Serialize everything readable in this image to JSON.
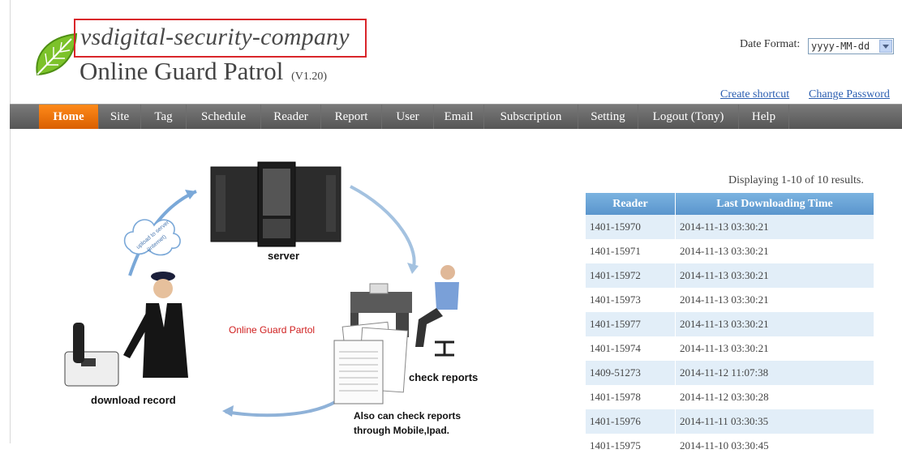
{
  "header": {
    "company_name": "vsdigital-security-company",
    "app_title": "Online Guard Patrol",
    "app_version": "(V1.20)",
    "date_format_label": "Date Format:",
    "date_format_value": "yyyy-MM-dd",
    "links": {
      "create_shortcut": "Create shortcut",
      "change_password": "Change Password"
    }
  },
  "nav": {
    "active": "Home",
    "items": [
      "Home",
      "Site",
      "Tag",
      "Schedule",
      "Reader",
      "Report",
      "User",
      "Email",
      "Subscription",
      "Setting",
      "Logout (Tony)",
      "Help"
    ]
  },
  "diagram": {
    "server_label": "server",
    "check_reports_label": "check reports",
    "download_record_label": "download record",
    "center_label": "Online Guard Partol",
    "mobile_label_line1": "Also can check reports",
    "mobile_label_line2": "through Mobile,Ipad.",
    "cloud_label_line1": "upload to server",
    "cloud_label_line2": "(Internet)"
  },
  "results": {
    "summary": "Displaying 1-10 of 10 results.",
    "columns": [
      "Reader",
      "Last Downloading Time"
    ],
    "rows": [
      [
        "1401-15970",
        "2014-11-13 03:30:21"
      ],
      [
        "1401-15971",
        "2014-11-13 03:30:21"
      ],
      [
        "1401-15972",
        "2014-11-13 03:30:21"
      ],
      [
        "1401-15973",
        "2014-11-13 03:30:21"
      ],
      [
        "1401-15977",
        "2014-11-13 03:30:21"
      ],
      [
        "1401-15974",
        "2014-11-13 03:30:21"
      ],
      [
        "1409-51273",
        "2014-11-12 11:07:38"
      ],
      [
        "1401-15978",
        "2014-11-12 03:30:28"
      ],
      [
        "1401-15976",
        "2014-11-11 03:30:35"
      ],
      [
        "1401-15975",
        "2014-11-10 03:30:45"
      ]
    ]
  },
  "colors": {
    "nav_active": "#f07a10",
    "table_header": "#6aa5d8",
    "highlight_box": "#d9252a",
    "link": "#2a5db0"
  }
}
